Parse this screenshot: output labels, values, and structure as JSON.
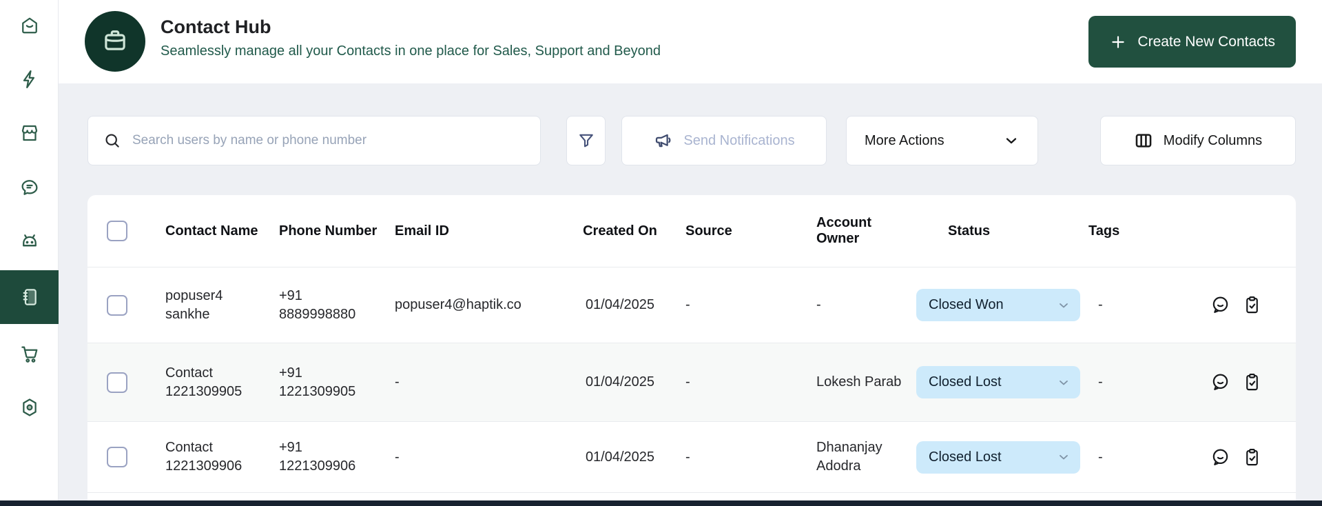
{
  "header": {
    "title": "Contact Hub",
    "subtitle": "Seamlessly manage all your Contacts in one place for Sales, Support and Beyond",
    "create_button_label": "Create New Contacts"
  },
  "sidebar": {
    "items": [
      {
        "icon": "home-icon",
        "active": false
      },
      {
        "icon": "lightning-icon",
        "active": false
      },
      {
        "icon": "storefront-icon",
        "active": false
      },
      {
        "icon": "chat-bubble-icon",
        "active": false
      },
      {
        "icon": "robot-icon",
        "active": false
      },
      {
        "icon": "contacts-book-icon",
        "active": true
      },
      {
        "icon": "cart-icon",
        "active": false
      },
      {
        "icon": "settings-hexagon-icon",
        "active": false
      }
    ]
  },
  "toolbar": {
    "search_placeholder": "Search users by name or phone number",
    "send_notifications_label": "Send Notifications",
    "more_actions_label": "More Actions",
    "modify_columns_label": "Modify Columns"
  },
  "table": {
    "columns": [
      "Contact Name",
      "Phone Number",
      "Email ID",
      "Created On",
      "Source",
      "Account Owner",
      "Status",
      "Tags"
    ],
    "rows": [
      {
        "name1": "popuser4",
        "name2": "sankhe",
        "phone1": "+91",
        "phone2": "8889998880",
        "email": "popuser4@haptik.co",
        "created_on": "01/04/2025",
        "source": "-",
        "owner1": "-",
        "owner2": "",
        "status": "Closed Won",
        "tags": "-"
      },
      {
        "name1": "Contact",
        "name2": "1221309905",
        "phone1": "+91",
        "phone2": "1221309905",
        "email": "-",
        "created_on": "01/04/2025",
        "source": "-",
        "owner1": "Lokesh Parab",
        "owner2": "",
        "status": "Closed Lost",
        "tags": "-"
      },
      {
        "name1": "Contact",
        "name2": "1221309906",
        "phone1": "+91",
        "phone2": "1221309906",
        "email": "-",
        "created_on": "01/04/2025",
        "source": "-",
        "owner1": "Dhananjay",
        "owner2": "Adodra",
        "status": "Closed Lost",
        "tags": "-"
      }
    ]
  },
  "colors": {
    "primary_green": "#21503f",
    "avatar_green": "#10352a",
    "active_sidebar_green": "#1e4a3b",
    "status_pill_blue": "#cdeafb",
    "page_background": "#eef0f4",
    "subtitle_green": "#215a4b",
    "bottom_bar": "#182230"
  }
}
